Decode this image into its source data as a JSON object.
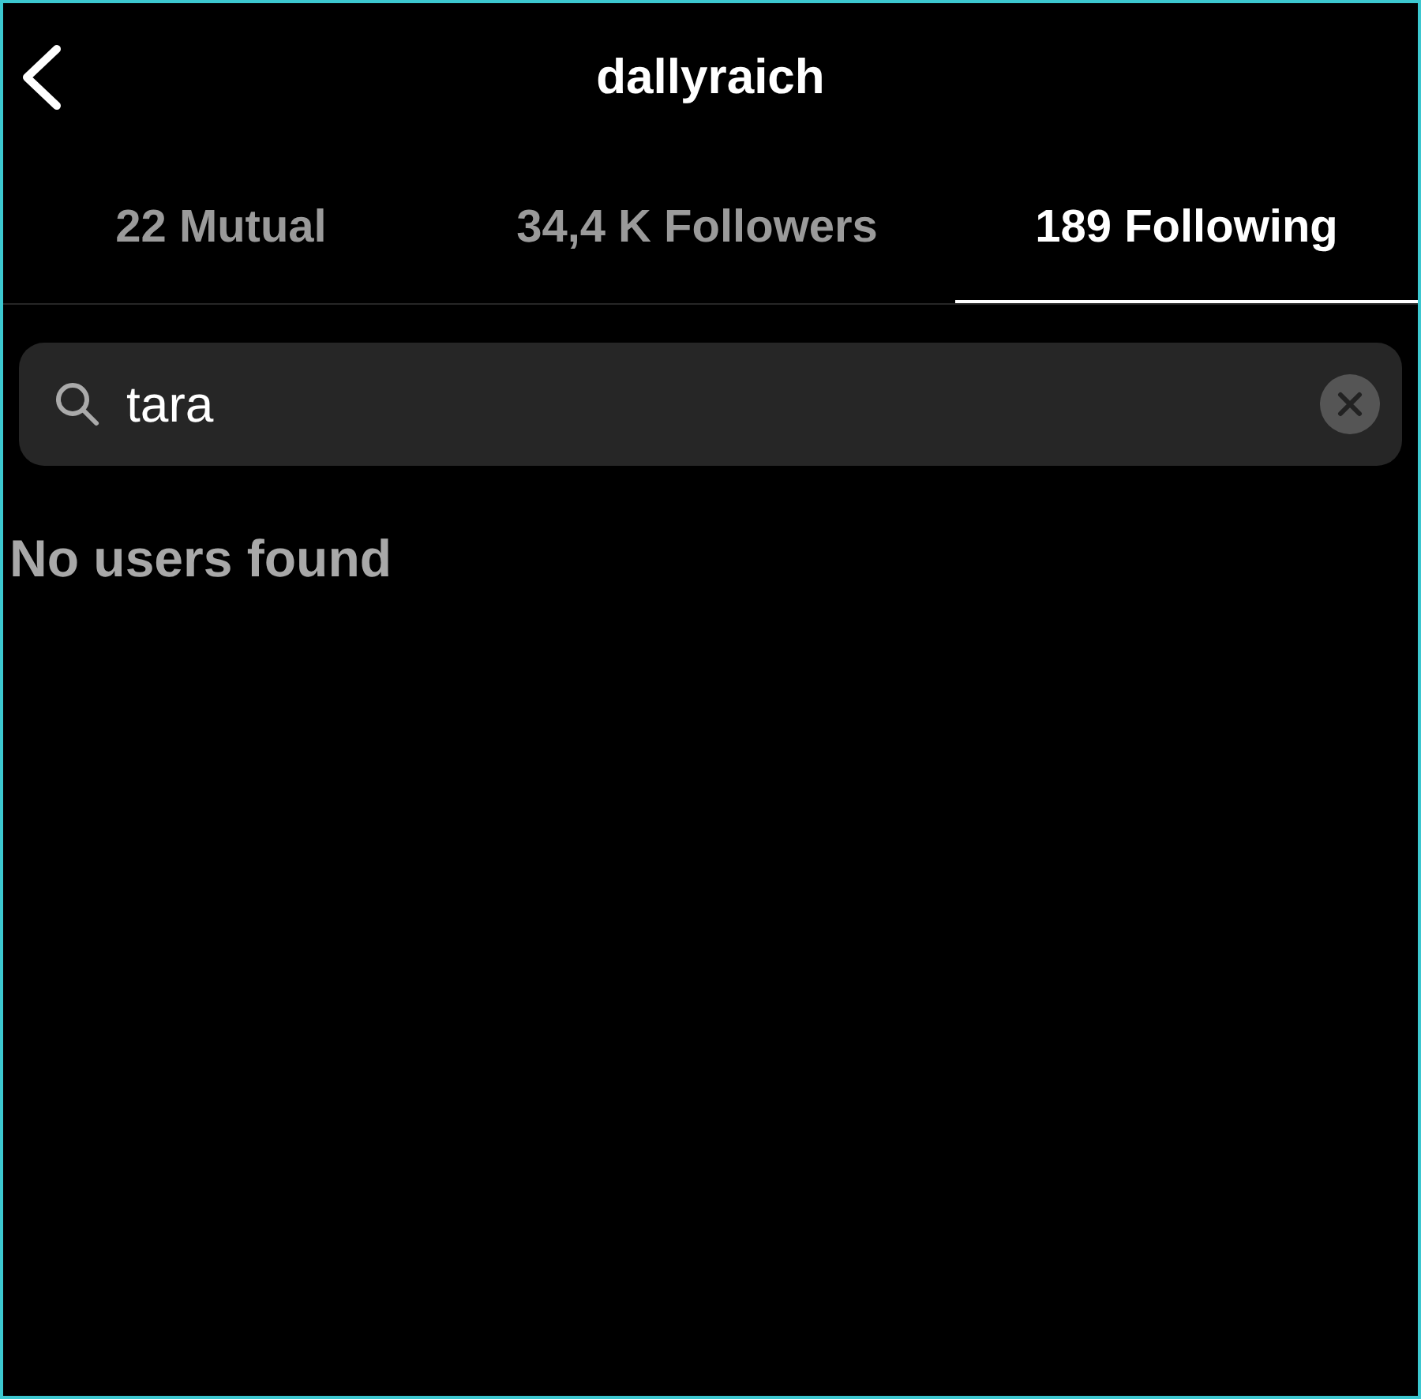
{
  "header": {
    "title": "dallyraich"
  },
  "tabs": [
    {
      "label": "22 Mutual",
      "selected": false
    },
    {
      "label": "34,4 K Followers",
      "selected": false
    },
    {
      "label": "189 Following",
      "selected": true
    }
  ],
  "search": {
    "value": "tara"
  },
  "message": "No users found"
}
